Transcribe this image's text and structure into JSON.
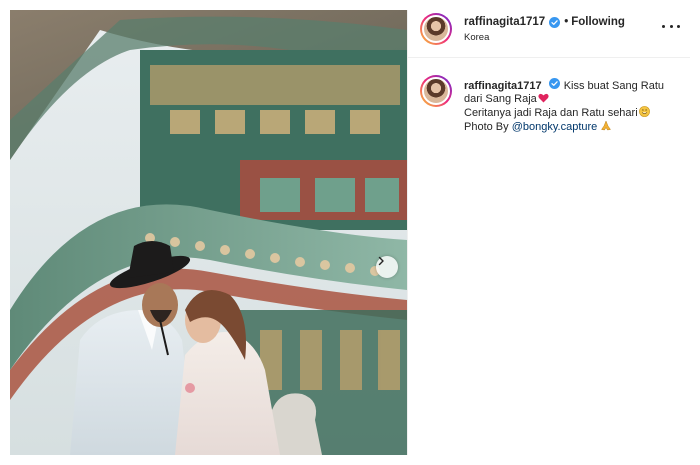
{
  "post": {
    "username": "raffinagita1717",
    "follow_status": "Following",
    "location": "Korea",
    "caption": {
      "username": "raffinagita1717",
      "line1": "Kiss buat Sang Ratu dari Sang Raja",
      "line2": "Ceritanya jadi Raja dan Ratu sehari",
      "line3_prefix": "Photo By ",
      "mention": "@bongky.capture"
    }
  },
  "icons": {
    "verified": "verified-badge-icon",
    "more": "more-options-icon",
    "next": "chevron-right-icon",
    "heart": "red-heart-emoji",
    "face": "smiling-face-emoji",
    "pray": "folded-hands-emoji"
  },
  "colors": {
    "verified": "#3897f0",
    "mention": "#00376b",
    "heart": "#e0245e",
    "divider": "#efefef"
  }
}
